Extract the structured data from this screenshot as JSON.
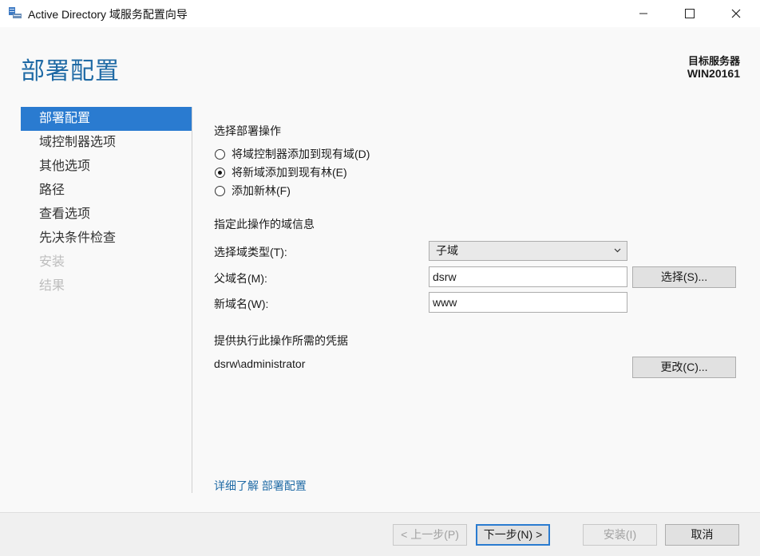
{
  "window": {
    "title": "Active Directory 域服务配置向导",
    "minimize_icon": "minimize-icon",
    "maximize_icon": "maximize-icon",
    "close_icon": "close-icon"
  },
  "header": {
    "page_title": "部署配置",
    "target_label": "目标服务器",
    "target_value": "WIN20161"
  },
  "nav": {
    "items": [
      {
        "label": "部署配置",
        "state": "active"
      },
      {
        "label": "域控制器选项",
        "state": "normal"
      },
      {
        "label": "其他选项",
        "state": "normal"
      },
      {
        "label": "路径",
        "state": "normal"
      },
      {
        "label": "查看选项",
        "state": "normal"
      },
      {
        "label": "先决条件检查",
        "state": "normal"
      },
      {
        "label": "安装",
        "state": "disabled"
      },
      {
        "label": "结果",
        "state": "disabled"
      }
    ]
  },
  "deploy": {
    "heading": "选择部署操作",
    "options": [
      {
        "label": "将域控制器添加到现有域(D)",
        "checked": false
      },
      {
        "label": "将新域添加到现有林(E)",
        "checked": true
      },
      {
        "label": "添加新林(F)",
        "checked": false
      }
    ]
  },
  "domain_info": {
    "heading": "指定此操作的域信息",
    "type_label": "选择域类型(T):",
    "type_value": "子域",
    "parent_label": "父域名(M):",
    "parent_value": "dsrw",
    "select_button": "选择(S)...",
    "new_label": "新域名(W):",
    "new_value": "www"
  },
  "credentials": {
    "heading": "提供执行此操作所需的凭据",
    "user": "dsrw\\administrator",
    "change_button": "更改(C)..."
  },
  "link": {
    "text": "详细了解 部署配置"
  },
  "footer": {
    "prev": "< 上一步(P)",
    "next": "下一步(N) >",
    "install": "安装(I)",
    "cancel": "取消"
  },
  "colors": {
    "accent": "#2a7bd0",
    "title_blue": "#1f6aa5"
  }
}
